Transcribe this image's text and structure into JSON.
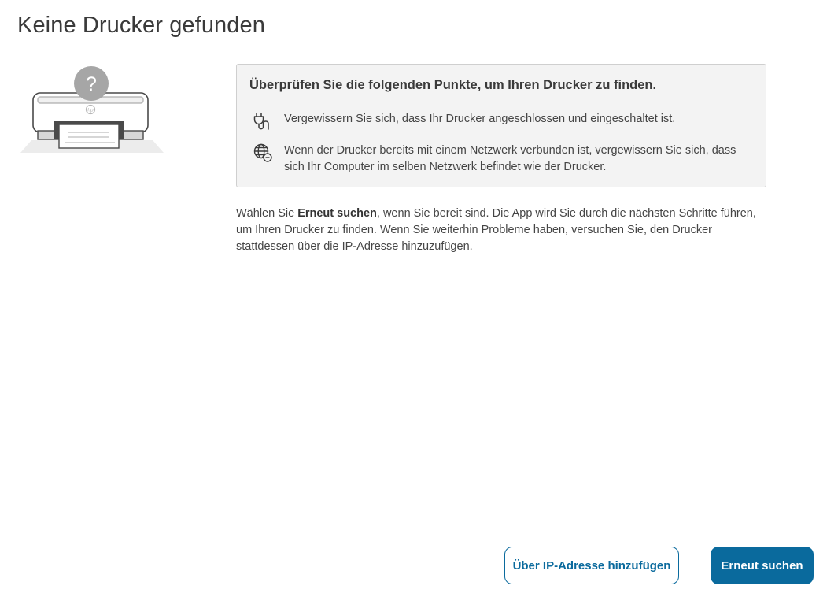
{
  "page": {
    "title": "Keine Drucker gefunden"
  },
  "illustration": {
    "badge_symbol": "?",
    "logo_text": "hp",
    "icon": "printer-not-found-illustration"
  },
  "tips": {
    "heading": "Überprüfen Sie die folgenden Punkte, um Ihren Drucker zu finden.",
    "items": [
      {
        "icon": "power-plug-icon",
        "text": "Vergewissern Sie sich, dass Ihr Drucker angeschlossen und eingeschaltet ist."
      },
      {
        "icon": "network-globe-icon",
        "text": "Wenn der Drucker bereits mit einem Netzwerk verbunden ist, vergewissern Sie sich, dass sich Ihr Computer im selben Netzwerk befindet wie der Drucker."
      }
    ]
  },
  "instructions": {
    "prefix": "Wählen Sie ",
    "emphasis": "Erneut suchen",
    "suffix": ", wenn Sie bereit sind. Die App wird Sie durch die nächsten Schritte führen, um Ihren Drucker zu finden. Wenn Sie weiterhin Probleme haben, versuchen Sie, den Drucker stattdessen über die IP-Adresse hinzuzufügen."
  },
  "actions": {
    "add_by_ip_label": "Über IP-Adresse hinzufügen",
    "retry_label": "Erneut suchen"
  },
  "colors": {
    "accent": "#0a6a9d",
    "panel_background": "#f3f3f3",
    "panel_border": "#cfcfcf",
    "text": "#3c3c3c"
  }
}
